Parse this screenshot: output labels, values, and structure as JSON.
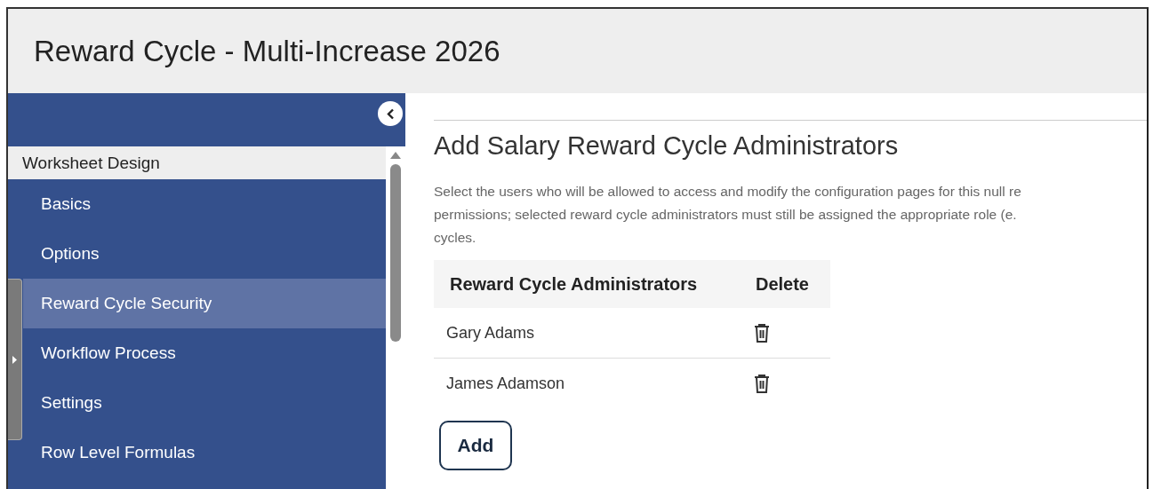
{
  "header": {
    "title": "Reward Cycle - Multi-Increase 2026"
  },
  "sidebar": {
    "section": "Worksheet Design",
    "items": [
      {
        "label": "Basics",
        "selected": false
      },
      {
        "label": "Options",
        "selected": false
      },
      {
        "label": "Reward Cycle Security",
        "selected": true
      },
      {
        "label": "Workflow Process",
        "selected": false
      },
      {
        "label": "Settings",
        "selected": false
      },
      {
        "label": "Row Level Formulas",
        "selected": false
      }
    ]
  },
  "content": {
    "heading": "Add Salary Reward Cycle Administrators",
    "description_lines": [
      "Select the users who will be allowed to access and modify the configuration pages for this null re",
      "permissions; selected reward cycle administrators must still be assigned the appropriate role (e.",
      "cycles."
    ],
    "table": {
      "columns": [
        "Reward Cycle Administrators",
        "Delete"
      ],
      "rows": [
        {
          "name": "Gary Adams"
        },
        {
          "name": "James Adamson"
        }
      ]
    },
    "add_button": "Add"
  }
}
